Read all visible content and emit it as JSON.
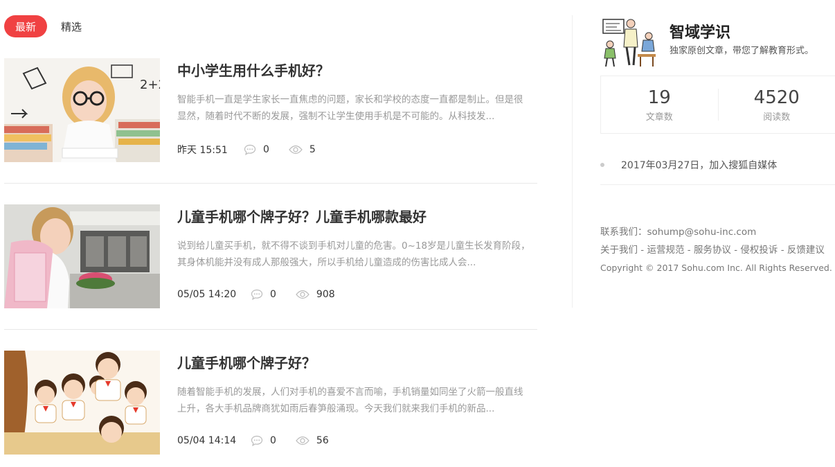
{
  "tabs": {
    "active": "最新",
    "other": "精选"
  },
  "articles": [
    {
      "title": "中小学生用什么手机好？",
      "desc": "智能手机一直是学生家长一直焦虑的问题，家长和学校的态度一直都是制止。但是很显然，随着时代不断的发展，强制不让学生使用手机是不可能的。从科技发...",
      "time": "昨天 15:51",
      "comments": "0",
      "views": "5"
    },
    {
      "title": "儿童手机哪个牌子好？儿童手机哪款最好",
      "desc": "说到给儿童买手机，就不得不谈到手机对儿童的危害。0~18岁是儿童生长发育阶段，其身体机能并没有成人那般强大，所以手机给儿童造成的伤害比成人会...",
      "time": "05/05 14:20",
      "comments": "0",
      "views": "908"
    },
    {
      "title": "儿童手机哪个牌子好？",
      "desc": "随着智能手机的发展，人们对手机的喜爱不言而喻，手机销量如同坐了火箭一般直线上升，各大手机品牌商犹如雨后春笋般涌现。今天我们就来我们手机的新品...",
      "time": "05/04 14:14",
      "comments": "0",
      "views": "56"
    }
  ],
  "profile": {
    "name": "智域学识",
    "desc": "独家原创文章，带您了解教育形式。",
    "articles_count": "19",
    "articles_label": "文章数",
    "reads_count": "4520",
    "reads_label": "阅读数",
    "joined": "2017年03月27日，加入搜狐自媒体"
  },
  "footer": {
    "contact": "联系我们：sohump@sohu-inc.com",
    "links": [
      "关于我们",
      "运营规范",
      "服务协议",
      "侵权投诉",
      "反馈建议"
    ],
    "sep": " - ",
    "copyright": "Copyright © 2017 Sohu.com Inc. All Rights Reserved."
  },
  "colors": {
    "accent": "#f04142"
  },
  "icons": {
    "comment": "comment-icon",
    "views": "eye-icon"
  }
}
